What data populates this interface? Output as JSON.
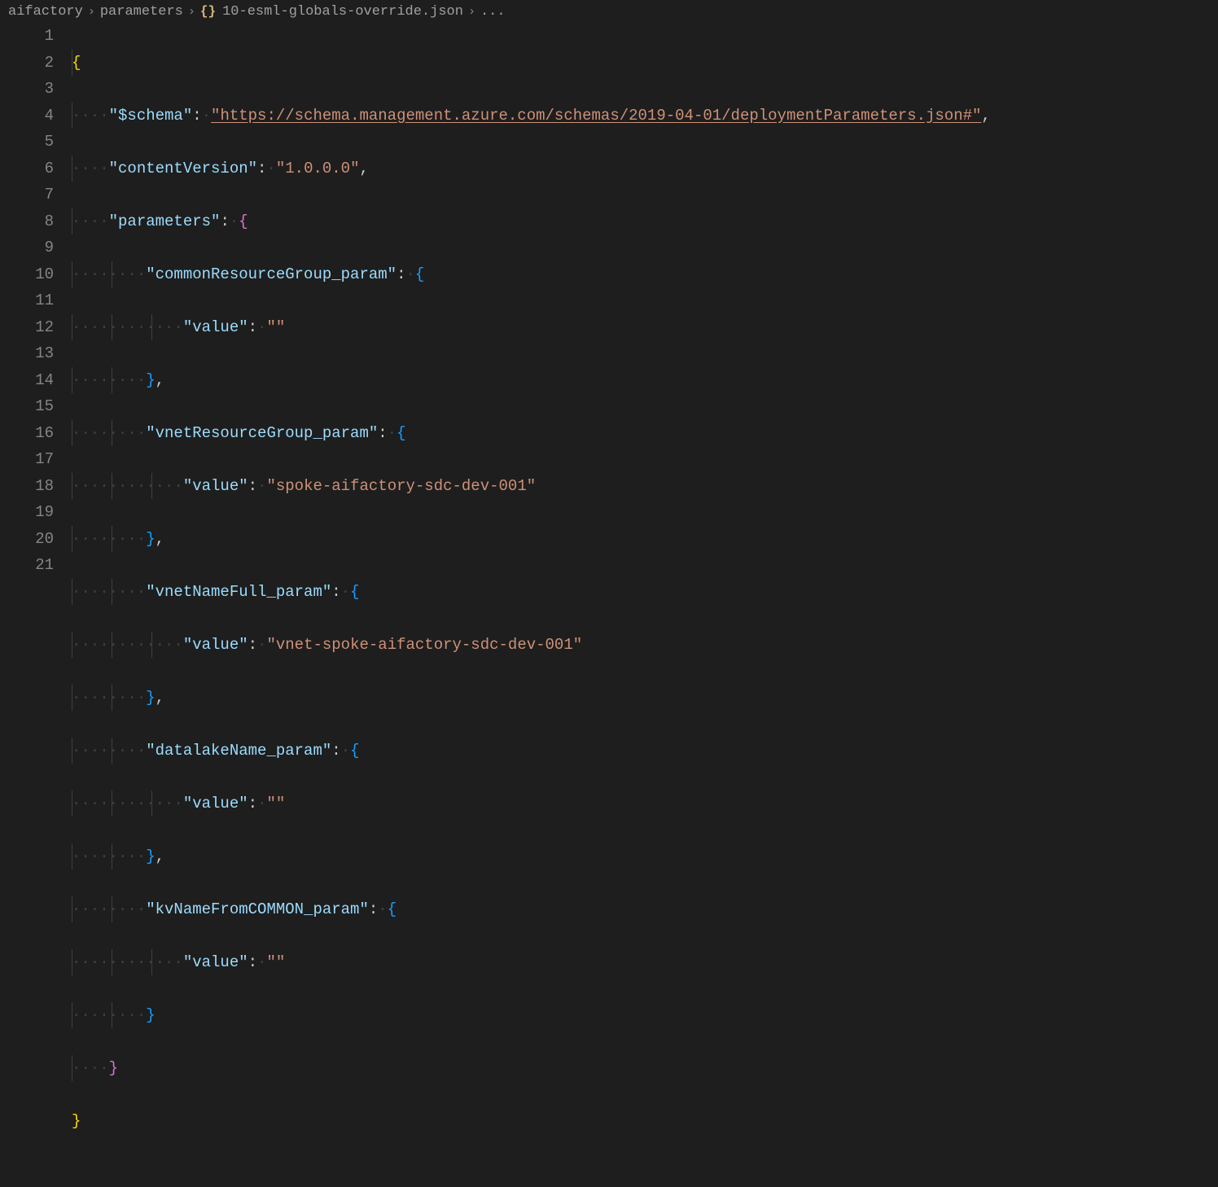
{
  "breadcrumb": {
    "seg1": "aifactory",
    "seg2": "parameters",
    "braces": "{}",
    "filename": "10-esml-globals-override.json",
    "trailing": "..."
  },
  "lineNumbers": [
    "1",
    "2",
    "3",
    "4",
    "5",
    "6",
    "7",
    "8",
    "9",
    "10",
    "11",
    "12",
    "13",
    "14",
    "15",
    "16",
    "17",
    "18",
    "19",
    "20",
    "21"
  ],
  "code": {
    "schemaKey": "\"$schema\"",
    "schemaVal": "\"https://schema.management.azure.com/schemas/2019-04-01/deploymentParameters.json#\"",
    "contentVersionKey": "\"contentVersion\"",
    "contentVersionVal": "\"1.0.0.0\"",
    "parametersKey": "\"parameters\"",
    "commonResourceGroupKey": "\"commonResourceGroup_param\"",
    "vnetResourceGroupKey": "\"vnetResourceGroup_param\"",
    "vnetResourceGroupVal": "\"spoke-aifactory-sdc-dev-001\"",
    "vnetNameFullKey": "\"vnetNameFull_param\"",
    "vnetNameFullVal": "\"vnet-spoke-aifactory-sdc-dev-001\"",
    "datalakeNameKey": "\"datalakeName_param\"",
    "kvNameKey": "\"kvNameFromCOMMON_param\"",
    "valueKey": "\"value\"",
    "emptyStr": "\"\"",
    "openBraceY": "{",
    "closeBraceY": "}",
    "openBraceP": "{",
    "closeBraceP": "}",
    "openBraceB": "{",
    "closeBraceB": "}",
    "comma": ",",
    "colon": ":",
    "dot": "·"
  }
}
